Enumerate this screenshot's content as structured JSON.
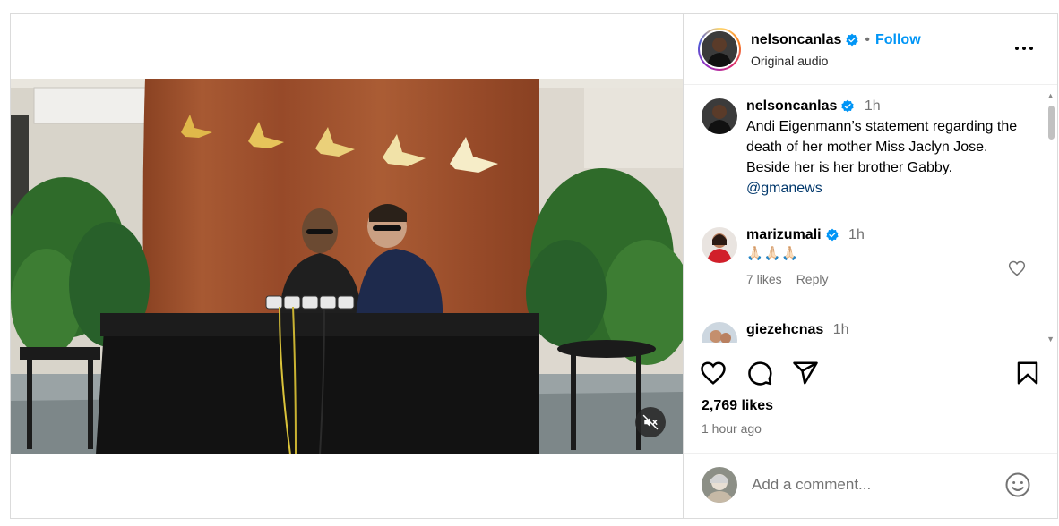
{
  "post": {
    "username": "nelsoncanlas",
    "follow_label": "Follow",
    "separator": "•",
    "audio_label": "Original audio",
    "caption": {
      "username": "nelsoncanlas",
      "time": "1h",
      "text": "Andi Eigenmann’s statement regarding the death of her mother Miss Jaclyn Jose. Beside her is her brother Gabby.",
      "mention": "@gmanews"
    },
    "comments": [
      {
        "username": "marizumali",
        "time": "1h",
        "text": "🙏🏻🙏🏻🙏🏻",
        "likes": "7 likes",
        "reply_label": "Reply"
      },
      {
        "username": "giezehcnas",
        "time": "1h"
      }
    ],
    "likes_count": "2,769 likes",
    "posted_ago": "1 hour ago",
    "add_comment_placeholder": "Add a comment..."
  },
  "colors": {
    "accent": "#0095f6",
    "verified": "#0095f6",
    "muted_text": "#737373",
    "mention": "#00376b",
    "border": "#dbdbdb"
  },
  "icons": {
    "verified": "verified-badge-icon",
    "more": "more-options-icon",
    "like": "heart-icon",
    "comment": "comment-icon",
    "share": "share-icon",
    "save": "bookmark-icon",
    "mute": "muted-speaker-icon",
    "emoji": "smiley-icon"
  }
}
